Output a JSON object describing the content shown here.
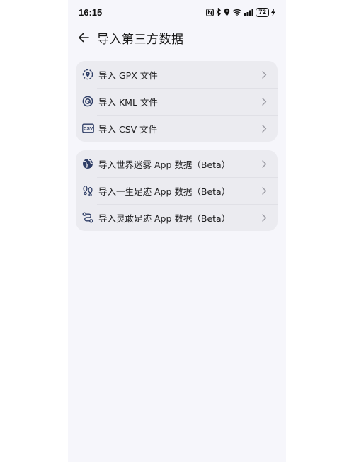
{
  "status_bar": {
    "time": "16:15",
    "battery": "72",
    "icons": [
      "nfc-icon",
      "bluetooth-icon",
      "location-icon",
      "wifi-icon",
      "signal-icon",
      "battery-icon",
      "charging-icon"
    ]
  },
  "header": {
    "title": "导入第三方数据",
    "back_icon": "arrow-left-icon"
  },
  "groups": [
    {
      "items": [
        {
          "label": "导入 GPX 文件",
          "icon": "map-pin-icon"
        },
        {
          "label": "导入 KML 文件",
          "icon": "target-icon"
        },
        {
          "label": "导入 CSV 文件",
          "icon": "csv-file-icon"
        }
      ]
    },
    {
      "items": [
        {
          "label": "导入世界迷雾 App 数据（Beta）",
          "icon": "globe-icon"
        },
        {
          "label": "导入一生足迹 App 数据（Beta）",
          "icon": "footprints-icon"
        },
        {
          "label": "导入灵敢足迹 App 数据（Beta）",
          "icon": "route-icon"
        }
      ]
    }
  ],
  "colors": {
    "background": "#f6f6fb",
    "card": "#ebebf0",
    "icon": "#2f3e66",
    "chevron": "#9a9aa2"
  }
}
